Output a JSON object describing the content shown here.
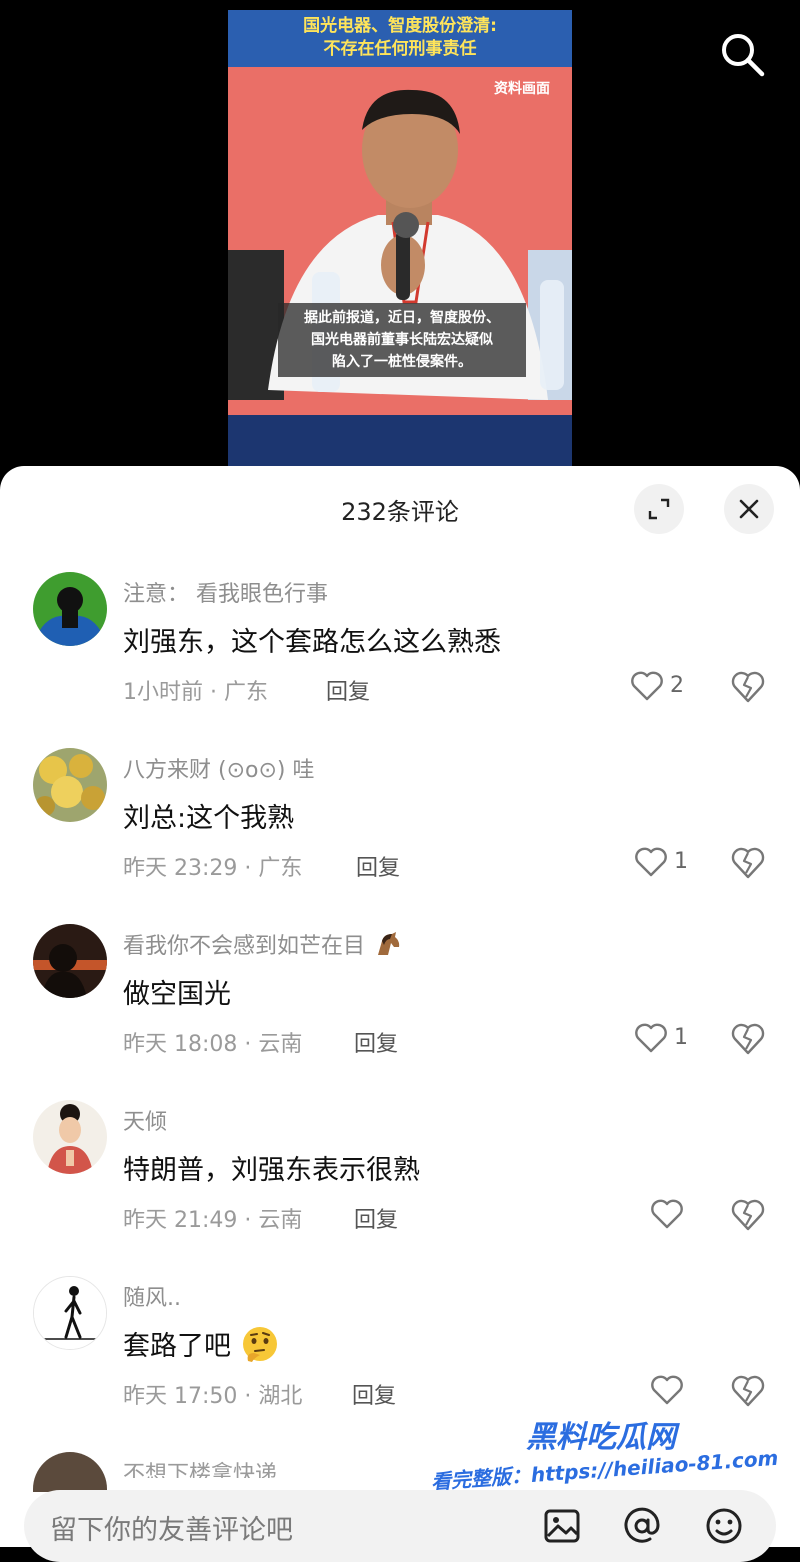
{
  "video": {
    "banner_line1": "国光电器、智度股份澄清:",
    "banner_line2": "不存在任何刑事责任",
    "ref_label": "资料画面",
    "caption_line1": "据此前报道，近日，智度股份、",
    "caption_line2": "国光电器前董事长陆宏达疑似",
    "caption_line3": "陷入了一桩性侵案件。"
  },
  "header": {
    "comment_count": "232条评论"
  },
  "comments": [
    {
      "username": "注意：  看我眼色行事",
      "text": "刘强东，这个套路怎么这么熟悉",
      "meta": "1小时前 · 广东",
      "reply": "回复",
      "likes": "2",
      "avatar": "avatar-silhouette"
    },
    {
      "username": "八方来财 (⊙o⊙) 哇",
      "text": "刘总:这个我熟",
      "meta": "昨天 23:29 · 广东",
      "reply": "回复",
      "likes": "1",
      "avatar": "avatar-flowers"
    },
    {
      "username": "看我你不会感到如芒在目",
      "text": "做空国光",
      "meta": "昨天 18:08 · 云南",
      "reply": "回复",
      "likes": "1",
      "avatar": "avatar-sunset"
    },
    {
      "username": "天倾",
      "text": "特朗普，刘强东表示很熟",
      "meta": "昨天 21:49 · 云南",
      "reply": "回复",
      "likes": "",
      "avatar": "avatar-portrait"
    },
    {
      "username": "随风..",
      "text": "套路了吧",
      "meta": "昨天 17:50 · 湖北",
      "reply": "回复",
      "likes": "",
      "avatar": "avatar-stickman"
    }
  ],
  "partial_comment": {
    "username": "不想下楼拿快递"
  },
  "input": {
    "placeholder": "留下你的友善评论吧"
  },
  "watermark": {
    "title": "黑料吃瓜网",
    "url": "看完整版：https://heiliao-81.com"
  }
}
